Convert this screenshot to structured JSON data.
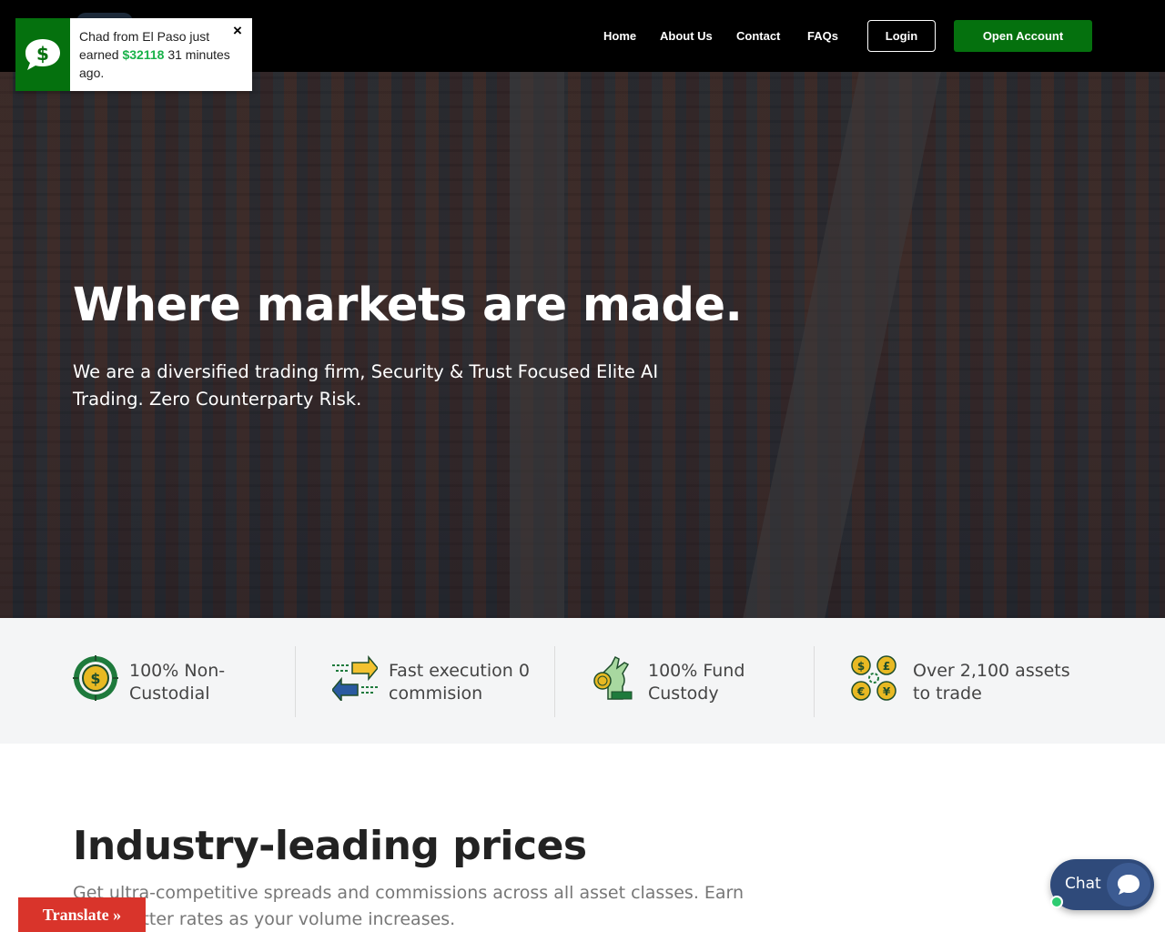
{
  "header": {
    "nav": [
      {
        "label": "Home"
      },
      {
        "label": "About Us"
      },
      {
        "label": "Contact"
      },
      {
        "label": "FAQs"
      }
    ],
    "login_label": "Login",
    "open_account_label": "Open Account"
  },
  "notification": {
    "text_before": "Chad from El Paso just earned ",
    "amount": "$32118",
    "text_after": " 31 minutes ago.",
    "close": "×",
    "icon": "dollar-chat-icon"
  },
  "hero": {
    "title": "Where markets are made.",
    "subtitle": "We are a diversified trading firm, Security & Trust Focused Elite AI Trading. Zero Counterparty Risk."
  },
  "features": [
    {
      "text": "100% Non-Custodial",
      "icon": "dollar-target-icon"
    },
    {
      "text": "Fast execution 0 commision",
      "icon": "exchange-arrows-icon"
    },
    {
      "text": "100% Fund Custody",
      "icon": "hand-coin-icon"
    },
    {
      "text": "Over 2,100 assets to trade",
      "icon": "currency-symbols-icon"
    }
  ],
  "prices": {
    "title": "Industry-leading prices",
    "subtitle": "Get ultra-competitive spreads and commissions across all asset classes. Earn even better rates as your volume increases."
  },
  "translate_label": "Translate »",
  "chat": {
    "label": "Chat"
  },
  "colors": {
    "brand_green": "#05710e",
    "accent_green": "#19b24a",
    "translate_red": "#d9342b",
    "chat_blue": "#2f4a7a"
  }
}
